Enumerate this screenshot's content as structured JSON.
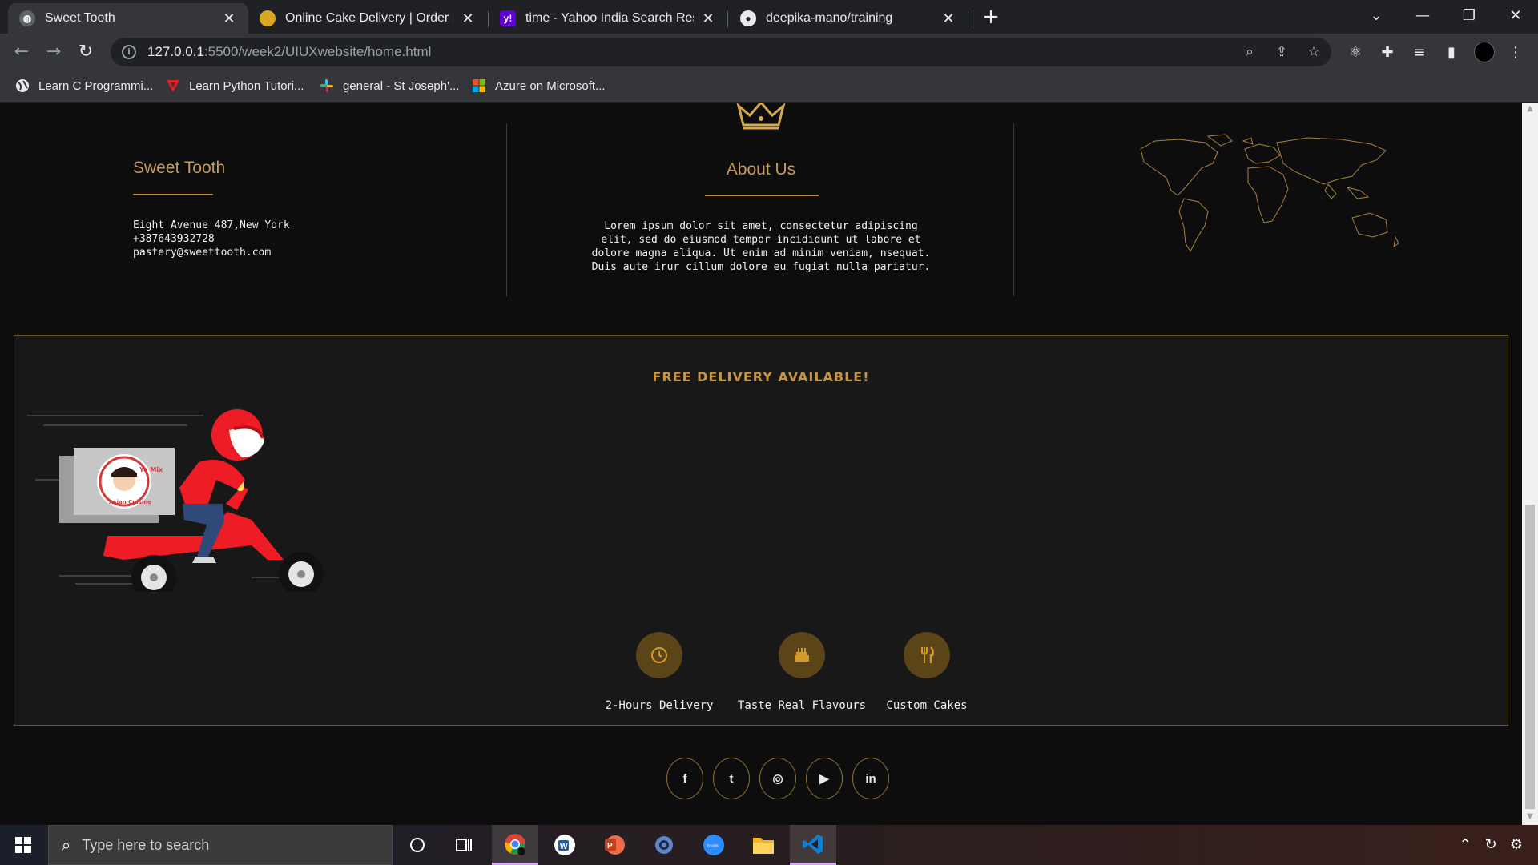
{
  "browser": {
    "tabs": [
      {
        "title": "Sweet Tooth",
        "active": true,
        "favicon": "globe-icon"
      },
      {
        "title": "Online Cake Delivery | Order Best",
        "active": false,
        "favicon": "cake-icon"
      },
      {
        "title": "time - Yahoo India Search Results",
        "active": false,
        "favicon": "yahoo-icon"
      },
      {
        "title": "deepika-mano/training",
        "active": false,
        "favicon": "github-icon"
      }
    ],
    "url_host": "127.0.0.1",
    "url_path": ":5500/week2/UIUXwebsite/home.html",
    "bookmarks": [
      {
        "label": "Learn C Programmi...",
        "icon": "globe-icon"
      },
      {
        "label": "Learn Python Tutori...",
        "icon": "tutorial-logo-icon"
      },
      {
        "label": "general - St Joseph'...",
        "icon": "slack-icon"
      },
      {
        "label": "Azure on Microsoft...",
        "icon": "microsoft-icon"
      }
    ]
  },
  "footer": {
    "brand_title": "Sweet Tooth",
    "contact": {
      "address": "Eight Avenue 487,New York",
      "phone": "+387643932728",
      "email": "pastery@sweettooth.com"
    },
    "about_title": "About Us",
    "about_text": "Lorem ipsum dolor sit amet, consectetur adipiscing elit, sed do eiusmod tempor incididunt ut labore et dolore magna aliqua. Ut enim ad minim veniam, nsequat. Duis aute irur cillum dolore eu fugiat nulla pariatur."
  },
  "delivery": {
    "title": "FREE DELIVERY AVAILABLE!",
    "scooter_box_text": "Yo Mix",
    "scooter_box_subtext": "Asian Cuisine",
    "features": [
      {
        "label": "2-Hours Delivery",
        "icon": "clock-icon"
      },
      {
        "label": "Taste Real Flavours",
        "icon": "cake-icon"
      },
      {
        "label": "Custom Cakes",
        "icon": "utensils-icon"
      }
    ]
  },
  "social": [
    {
      "name": "facebook",
      "glyph": "f"
    },
    {
      "name": "twitter",
      "glyph": "t"
    },
    {
      "name": "instagram",
      "glyph": "◎"
    },
    {
      "name": "youtube",
      "glyph": "▶"
    },
    {
      "name": "linkedin",
      "glyph": "in"
    }
  ],
  "taskbar": {
    "search_placeholder": "Type here to search"
  },
  "colors": {
    "accent_gold": "#c9953d",
    "page_bg": "#0d0d0d",
    "panel_bg": "#181818"
  }
}
